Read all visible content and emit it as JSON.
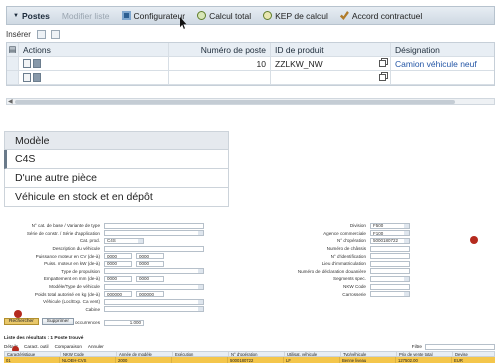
{
  "toolbar": {
    "postes": "Postes",
    "modifier": "Modifier liste",
    "configurateur": "Configurateur",
    "calcul": "Calcul total",
    "kep": "KEP de calcul",
    "accord": "Accord contractuel"
  },
  "insert_bar": {
    "label": "Insérer"
  },
  "items_table": {
    "headers": {
      "actions": "Actions",
      "num": "Numéro de poste",
      "prod": "ID de produit",
      "des": "Désignation"
    },
    "rows": [
      {
        "num": "10",
        "prod": "ZZLKW_NW",
        "des": "Camion véhicule neuf"
      },
      {
        "num": "",
        "prod": "",
        "des": ""
      }
    ]
  },
  "model_list": {
    "header": "Modèle",
    "items": [
      "C4S",
      "D'une autre pièce",
      "Véhicule en stock et en dépôt"
    ]
  },
  "form": {
    "left": [
      {
        "label": "N° cat. de base / Variante de type",
        "value": ""
      },
      {
        "label": "Série de constr. / Série d'application",
        "value": ""
      },
      {
        "label": "Cat. prod.",
        "value": "C4S"
      },
      {
        "label": "Description du véhicule",
        "value": ""
      },
      {
        "label": "Puissance moteur en CV (de-à)",
        "v1": "0000",
        "v2": "0000"
      },
      {
        "label": "Puiss. moteur en kW (de-à)",
        "v1": "0000",
        "v2": "0000"
      },
      {
        "label": "Type de propulsion",
        "value": ""
      },
      {
        "label": "Empattement en mm (de-à)",
        "v1": "0000",
        "v2": "0000"
      },
      {
        "label": "Modèle/Type de véhicule",
        "value": ""
      },
      {
        "label": "Poids total autorisé en kg (de-à)",
        "v1": "000000",
        "v2": "000000"
      },
      {
        "label": "Véhicule (Loc/Exp. Ca vent)",
        "value": ""
      },
      {
        "label": "Cabine",
        "value": ""
      }
    ],
    "nb_max_label": "Nb max. occurrences",
    "nb_max_value": "1.000",
    "right": [
      {
        "label": "Division",
        "value": "F500"
      },
      {
        "label": "Agence commerciale",
        "value": "F100"
      },
      {
        "label": "N° d'opération",
        "value": "5000180722"
      },
      {
        "label": "Numéro de châssis",
        "value": ""
      },
      {
        "label": "N° d'identification",
        "value": ""
      },
      {
        "label": "Lieu d'immatriculation",
        "value": ""
      },
      {
        "label": "Numéro de déclaration douanière",
        "value": ""
      },
      {
        "label": "Segments spec.",
        "value": ""
      },
      {
        "label": "NKW Code",
        "value": ""
      },
      {
        "label": "Carrosserie",
        "value": ""
      }
    ]
  },
  "buttons": {
    "search": "Rechercher",
    "reset": "Supprimer"
  },
  "results": {
    "title": "Liste des résultats : 1 Poste trouvé",
    "tools": [
      "Détails",
      "Caract. outil",
      "Comparaison",
      "Annuler"
    ],
    "filter_label": "Filtre",
    "headers": [
      "Caractéristique",
      "NKW Code",
      "Année de modèle",
      "Exécution",
      "N° d'opération",
      "Utilisat. véhicule",
      "Typ/véhicule",
      "Prix de vente total",
      "Devise"
    ],
    "row": [
      "01",
      "NLOEH-CVS",
      "2000",
      "",
      "5000180722",
      "LF",
      "Benne liveau",
      "127502.00",
      "EUR"
    ]
  },
  "colors": {
    "accent": "#2456a6",
    "highlight": "#f4c64b",
    "marker": "#b52a1e"
  }
}
